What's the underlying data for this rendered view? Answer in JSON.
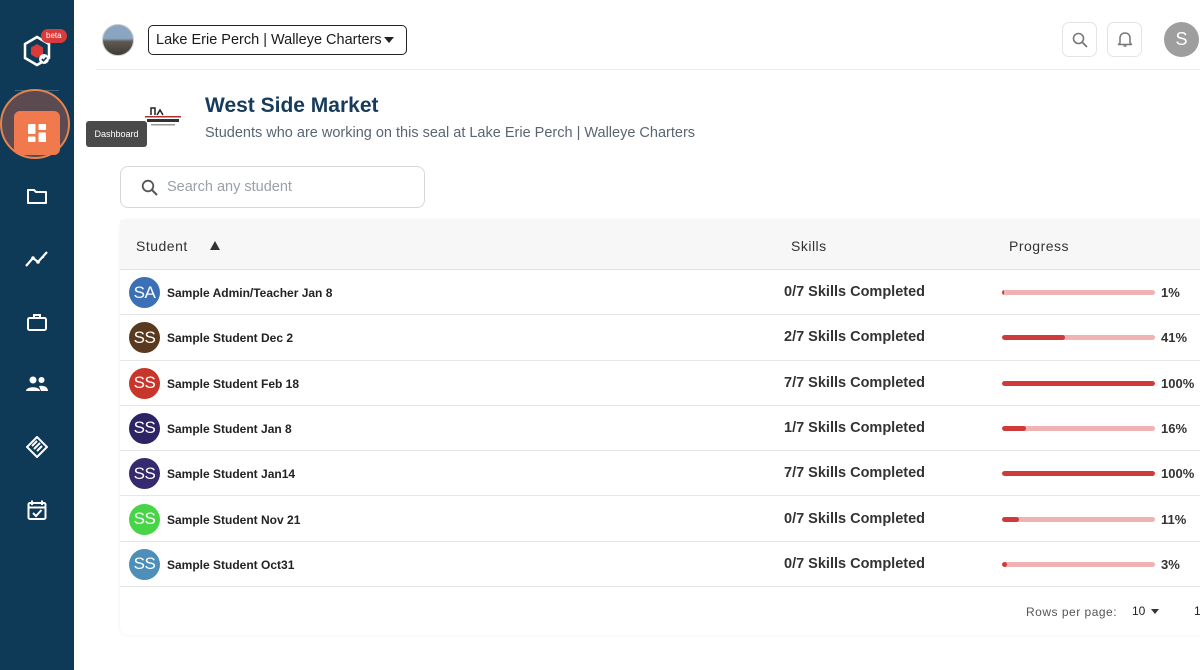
{
  "sidebar": {
    "beta_label": "beta",
    "tooltip": "Dashboard",
    "items": [
      {
        "icon": "dashboard-icon",
        "active": true
      },
      {
        "icon": "folder-icon"
      },
      {
        "icon": "analytics-icon"
      },
      {
        "icon": "briefcase-icon"
      },
      {
        "icon": "people-icon"
      },
      {
        "icon": "seal-icon"
      },
      {
        "icon": "calendar-check-icon"
      }
    ]
  },
  "header": {
    "org_name": "Lake Erie Perch | Walleye Charters",
    "user_initial": "S"
  },
  "page": {
    "title": "West Side Market",
    "subtitle": "Students who are working on this seal at Lake Erie Perch | Walleye Charters"
  },
  "search": {
    "placeholder": "Search any student",
    "value": ""
  },
  "table": {
    "headers": {
      "student": "Student",
      "skills": "Skills",
      "progress": "Progress"
    },
    "rows": [
      {
        "initials": "SA",
        "color": "#3b6fb6",
        "name": "Sample Admin/Teacher Jan 8",
        "skills": "0/7 Skills Completed",
        "progress": 1,
        "pct_label": "1%"
      },
      {
        "initials": "SS",
        "color": "#5a3a1e",
        "name": "Sample Student Dec 2",
        "skills": "2/7 Skills Completed",
        "progress": 41,
        "pct_label": "41%"
      },
      {
        "initials": "SS",
        "color": "#c8362b",
        "name": "Sample Student Feb 18",
        "skills": "7/7 Skills Completed",
        "progress": 100,
        "pct_label": "100%"
      },
      {
        "initials": "SS",
        "color": "#2d2466",
        "name": "Sample Student Jan 8",
        "skills": "1/7 Skills Completed",
        "progress": 16,
        "pct_label": "16%"
      },
      {
        "initials": "SS",
        "color": "#352a6e",
        "name": "Sample Student Jan14",
        "skills": "7/7 Skills Completed",
        "progress": 100,
        "pct_label": "100%"
      },
      {
        "initials": "SS",
        "color": "#47d447",
        "name": "Sample Student Nov 21",
        "skills": "0/7 Skills Completed",
        "progress": 11,
        "pct_label": "11%"
      },
      {
        "initials": "SS",
        "color": "#4d8fb8",
        "name": "Sample Student Oct31",
        "skills": "0/7 Skills Completed",
        "progress": 3,
        "pct_label": "3%"
      }
    ],
    "footer": {
      "rows_per_page_label": "Rows per page:",
      "rows_per_page_value": "10",
      "page_indicator": "1"
    }
  },
  "colors": {
    "sidebar_bg": "#0f3a57",
    "accent": "#f07a4e",
    "progress_fill": "#cf3a3a",
    "progress_track": "#efb3b3",
    "title": "#163b5c"
  }
}
